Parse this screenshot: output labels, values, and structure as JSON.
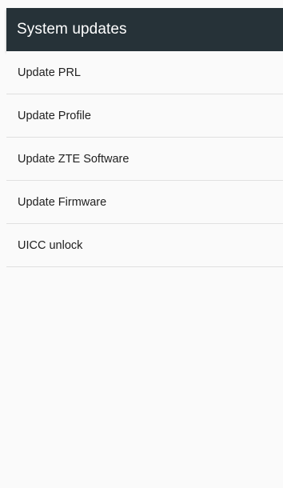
{
  "app_bar": {
    "title": "System updates",
    "background_color": "#263238"
  },
  "list": {
    "items": [
      {
        "label": "Update PRL"
      },
      {
        "label": "Update Profile"
      },
      {
        "label": "Update ZTE Software"
      },
      {
        "label": "Update Firmware"
      },
      {
        "label": "UICC unlock"
      }
    ]
  }
}
